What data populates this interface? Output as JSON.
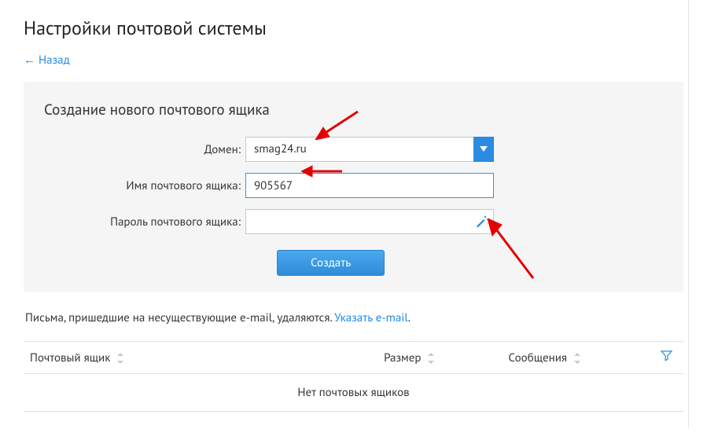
{
  "page": {
    "title": "Настройки почтовой системы",
    "back_label": "← Назад"
  },
  "panel": {
    "title": "Создание нового почтового ящика",
    "domain_label": "Домен:",
    "domain_value": "smag24.ru",
    "mailbox_label": "Имя почтового ящика:",
    "mailbox_value": "905567",
    "password_label": "Пароль почтового ящика:",
    "password_value": "",
    "submit_label": "Создать"
  },
  "info": {
    "text_prefix": "Письма, пришедшие на несуществующие e-mail, удаляются. ",
    "link_text": "Указать e-mail",
    "trailing": "."
  },
  "table": {
    "columns": {
      "mailbox": "Почтовый ящик",
      "size": "Размер",
      "messages": "Сообщения"
    },
    "empty_text": "Нет почтовых ящиков"
  }
}
